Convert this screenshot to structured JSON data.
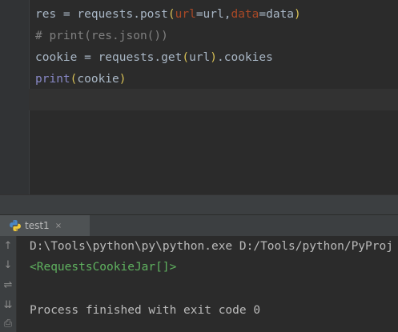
{
  "editor": {
    "lines": [
      {
        "tokens": [
          {
            "t": "res ",
            "c": "tok-plain"
          },
          {
            "t": "=",
            "c": "tok-op"
          },
          {
            "t": " requests.post",
            "c": "tok-plain"
          },
          {
            "t": "(",
            "c": "tok-paren"
          },
          {
            "t": "url",
            "c": "tok-param"
          },
          {
            "t": "=url,",
            "c": "tok-plain"
          },
          {
            "t": "data",
            "c": "tok-param"
          },
          {
            "t": "=data",
            "c": "tok-plain"
          },
          {
            "t": ")",
            "c": "tok-paren"
          }
        ]
      },
      {
        "tokens": [
          {
            "t": "# print(res.json())",
            "c": "tok-comment"
          }
        ]
      },
      {
        "tokens": [
          {
            "t": "cookie ",
            "c": "tok-plain"
          },
          {
            "t": "=",
            "c": "tok-op"
          },
          {
            "t": " requests.get",
            "c": "tok-plain"
          },
          {
            "t": "(",
            "c": "tok-paren"
          },
          {
            "t": "url",
            "c": "tok-plain"
          },
          {
            "t": ")",
            "c": "tok-paren"
          },
          {
            "t": ".cookies",
            "c": "tok-plain"
          }
        ]
      },
      {
        "tokens": [
          {
            "t": "print",
            "c": "tok-builtin"
          },
          {
            "t": "(",
            "c": "tok-paren"
          },
          {
            "t": "cookie",
            "c": "tok-plain"
          },
          {
            "t": ")",
            "c": "tok-paren"
          }
        ]
      }
    ]
  },
  "run": {
    "tab_label": "test1",
    "tab_close": "×",
    "tab_icon": "python-icon",
    "toolbar": [
      {
        "name": "up-arrow-icon",
        "glyph": "↑"
      },
      {
        "name": "down-arrow-icon",
        "glyph": "↓"
      },
      {
        "name": "soft-wrap-icon",
        "glyph": "⇌"
      },
      {
        "name": "scroll-to-end-icon",
        "glyph": "⇊"
      },
      {
        "name": "print-icon",
        "glyph": "⎙"
      }
    ],
    "console": [
      {
        "text": "D:\\Tools\\python\\py\\python.exe D:/Tools/python/PyProj",
        "kind": "console-cmd"
      },
      {
        "text": "<RequestsCookieJar[]>",
        "kind": "console-out"
      },
      {
        "text": "",
        "kind": "console-cmd"
      },
      {
        "text": "Process finished with exit code 0",
        "kind": "console-exit"
      }
    ]
  },
  "colors": {
    "editor_bg": "#2b2b2b",
    "gutter_bg": "#313335",
    "caret_row": "#323232",
    "panel_bg": "#3c3f41",
    "tab_active": "#4e5254",
    "output_green": "#5fb25f"
  }
}
